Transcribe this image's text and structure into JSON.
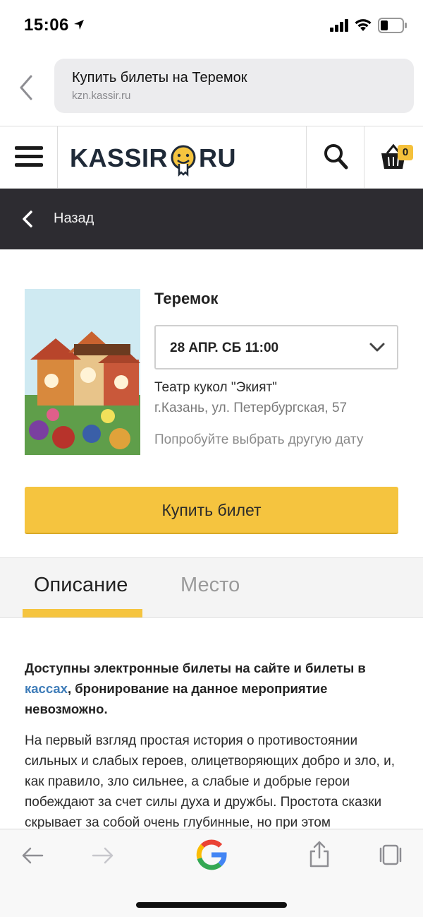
{
  "status_bar": {
    "time": "15:06"
  },
  "address_bar": {
    "title": "Купить билеты на Теремок",
    "url": "kzn.kassir.ru"
  },
  "header": {
    "logo_left": "KASSIR",
    "logo_right": "RU",
    "cart_count": "0"
  },
  "backnav": {
    "label": "Назад"
  },
  "event": {
    "title": "Теремок",
    "date_selected": "28 АПР. СБ 11:00",
    "venue": "Театр кукол \"Экият\"",
    "address": "г.Казань, ул. Петербургская, 57",
    "other_date_hint": "Попробуйте выбрать другую дату",
    "buy_label": "Купить билет"
  },
  "tabs": [
    {
      "label": "Описание",
      "active": true
    },
    {
      "label": "Место",
      "active": false
    }
  ],
  "description": {
    "bold_part1": "Доступны электронные билеты на сайте и билеты в ",
    "bold_link": "кассах",
    "bold_part2": ", бронирование на данное мероприятие невозможно.",
    "body": "На первый взгляд простая история о противостоянии сильных и слабых героев, олицетворяющих добро и зло, и, как правило, зло сильнее, а слабые и добрые герои побеждают за счет силы духа и дружбы. Простота сказки скрывает за собой очень глубинные, но при этом"
  },
  "colors": {
    "accent": "#f5c43f",
    "dark_bar": "#2d2c31",
    "link": "#3e7cb8"
  },
  "icons": {
    "back": "chevron-left-icon",
    "menu": "hamburger-icon",
    "search": "search-icon",
    "cart": "basket-icon",
    "dropdown": "chevron-down-icon"
  }
}
